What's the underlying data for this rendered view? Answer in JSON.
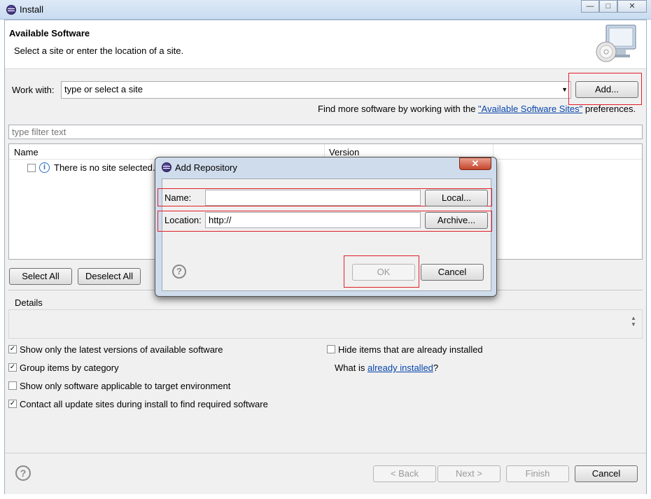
{
  "window": {
    "title": "Install"
  },
  "header": {
    "title": "Available Software",
    "description": "Select a site or enter the location of a site."
  },
  "work_with": {
    "label": "Work with:",
    "value": "type or select a site",
    "add_label": "Add..."
  },
  "find_more": {
    "prefix": "Find more software by working with the ",
    "link": "\"Available Software Sites\"",
    "suffix": " preferences."
  },
  "filter": {
    "placeholder": "type filter text"
  },
  "table": {
    "columns": [
      "Name",
      "Version"
    ],
    "rows": [
      {
        "name": "There is no site selected."
      }
    ]
  },
  "buttons": {
    "select_all": "Select All",
    "deselect_all": "Deselect All"
  },
  "details": {
    "label": "Details"
  },
  "options": [
    {
      "label": "Show only the latest versions of available software",
      "checked": true
    },
    {
      "label": "Group items by category",
      "checked": true
    },
    {
      "label": "Show only software applicable to target environment",
      "checked": false
    },
    {
      "label": "Contact all update sites during install to find required software",
      "checked": true
    }
  ],
  "hide_installed": {
    "label": "Hide items that are already installed",
    "checked": false
  },
  "what_is": {
    "prefix": "What is ",
    "link": "already installed",
    "suffix": "?"
  },
  "footer": {
    "back": "< Back",
    "next": "Next >",
    "finish": "Finish",
    "cancel": "Cancel"
  },
  "dialog": {
    "title": "Add Repository",
    "name_label": "Name:",
    "name_value": "",
    "local_label": "Local...",
    "location_label": "Location:",
    "location_value": "http://",
    "archive_label": "Archive...",
    "ok_label": "OK",
    "cancel_label": "Cancel"
  },
  "icons": {
    "help": "help-icon",
    "info": "info-icon",
    "app": "eclipse-icon"
  }
}
